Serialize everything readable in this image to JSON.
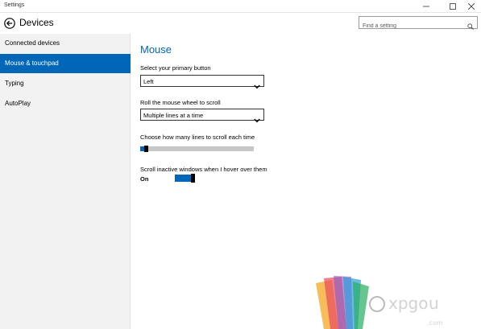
{
  "window": {
    "title": "Settings",
    "controls": {
      "minimize": "minimize-icon",
      "maximize": "maximize-icon",
      "close": "close-icon"
    }
  },
  "header": {
    "page_title": "Devices",
    "back_icon": "back-arrow-icon",
    "search": {
      "placeholder": "Find a setting",
      "value": "",
      "icon": "search-icon"
    }
  },
  "sidebar": {
    "items": [
      {
        "label": "Connected devices",
        "active": false
      },
      {
        "label": "Mouse & touchpad",
        "active": true
      },
      {
        "label": "Typing",
        "active": false
      },
      {
        "label": "AutoPlay",
        "active": false
      }
    ]
  },
  "main": {
    "section_title": "Mouse",
    "primary_button": {
      "label": "Select your primary button",
      "value": "Left"
    },
    "scroll_wheel": {
      "label": "Roll the mouse wheel to scroll",
      "value": "Multiple lines at a time"
    },
    "scroll_lines": {
      "label": "Choose how many lines to scroll each time",
      "level_fraction": 0.03
    },
    "inactive_scroll": {
      "label": "Scroll inactive windows when I hover over them",
      "state": "On",
      "on": true
    }
  },
  "colors": {
    "accent": "#0067b8",
    "sidebar_bg": "#f2f2f2",
    "text": "#000000"
  }
}
